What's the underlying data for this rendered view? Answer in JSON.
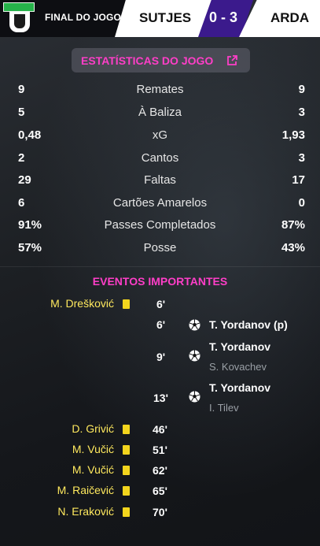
{
  "header": {
    "status": "FINAL DO JOGO",
    "home_team": "SUTJES",
    "score": "0 - 3",
    "away_team": "ARDA",
    "logo_text": "FK SUTJESKA"
  },
  "stats": {
    "button_label": "ESTATÍSTICAS DO JOGO",
    "rows": [
      {
        "home": "9",
        "label": "Remates",
        "away": "9"
      },
      {
        "home": "5",
        "label": "À Baliza",
        "away": "3"
      },
      {
        "home": "0,48",
        "label": "xG",
        "away": "1,93"
      },
      {
        "home": "2",
        "label": "Cantos",
        "away": "3"
      },
      {
        "home": "29",
        "label": "Faltas",
        "away": "17"
      },
      {
        "home": "6",
        "label": "Cartões Amarelos",
        "away": "0"
      },
      {
        "home": "91%",
        "label": "Passes Completados",
        "away": "87%"
      },
      {
        "home": "57%",
        "label": "Posse",
        "away": "43%"
      }
    ]
  },
  "events": {
    "title": "EVENTOS IMPORTANTES",
    "home_cards": [
      {
        "player": "M. Drešković",
        "minute": "6'"
      },
      {
        "player": "D. Grivić",
        "minute": "46'"
      },
      {
        "player": "M. Vučić",
        "minute": "51'"
      },
      {
        "player": "M. Vučić",
        "minute": "62'"
      },
      {
        "player": "M. Raičević",
        "minute": "65'"
      },
      {
        "player": "N. Eraković",
        "minute": "70'"
      }
    ],
    "away_goals": [
      {
        "minute": "6'",
        "scorer": "T. Yordanov (p)",
        "assist": ""
      },
      {
        "minute": "9'",
        "scorer": "T. Yordanov",
        "assist": "S. Kovachev"
      },
      {
        "minute": "13'",
        "scorer": "T. Yordanov",
        "assist": "I. Tilev"
      }
    ]
  },
  "colors": {
    "accent": "#ff3ec8",
    "card_yellow": "#f3d51d",
    "score_bg": "#3b1a8c"
  }
}
